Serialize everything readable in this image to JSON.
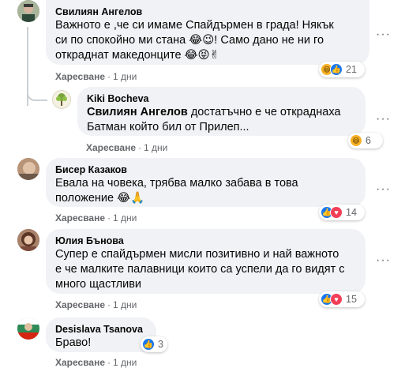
{
  "colors": {
    "bubble": "#f0f2f5",
    "meta": "#65676b",
    "like": "#1877f2",
    "love": "#f33e58",
    "haha": "#f7b125"
  },
  "like_label": "Харесване",
  "comments": [
    {
      "author": "Свилиян Ангелов",
      "lines": [
        "Важното е ,че си имаме Спайдърмен в града! Някък",
        "си по спокойно ми стана 😂😉! Само дано не ни го",
        "откраднат македонците 😂😝✌"
      ],
      "time": "1 дни",
      "reactions": {
        "icons": [
          "haha-icon",
          "like-icon"
        ],
        "count": "21"
      }
    },
    {
      "author": "Kiki Bocheva",
      "mention": "Свилиян Ангелов",
      "lines": [
        " достатъчно е че откраднаха",
        "Батман който бил от Прилеп..."
      ],
      "time": "1 дни",
      "reactions": {
        "icons": [
          "haha-icon"
        ],
        "count": "6"
      }
    },
    {
      "author": "Бисер Казаков",
      "lines": [
        "Евала на човека, трябва малко забава в това",
        "положение 😂🙏"
      ],
      "time": "1 дни",
      "reactions": {
        "icons": [
          "like-icon",
          "love-icon"
        ],
        "count": "14"
      }
    },
    {
      "author": "Юлия Бънова",
      "lines": [
        "Супер е спайдърмен мисли позитивно и най важното",
        "е че малките палавници които са успели да го видят с",
        "много щастливи"
      ],
      "time": "1 дни",
      "reactions": {
        "icons": [
          "like-icon",
          "love-icon"
        ],
        "count": "15"
      }
    },
    {
      "author": "Desislava Tsanova",
      "lines": [
        "Браво!"
      ],
      "time": "1 дни",
      "reactions": {
        "icons": [
          "like-icon"
        ],
        "count": "3"
      }
    }
  ]
}
